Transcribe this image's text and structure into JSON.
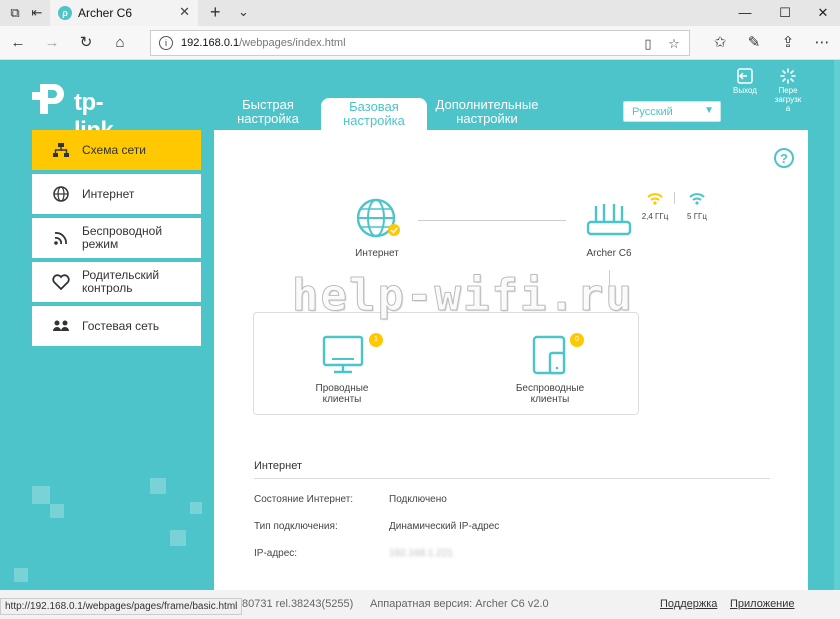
{
  "browser": {
    "tab_title": "Archer C6",
    "tab_close": "✕",
    "new_tab": "+",
    "tab_list": "⌄",
    "url_host": "192.168.0.1",
    "url_path": "/webpages/index.html",
    "status_url": "http://192.168.0.1/webpages/pages/frame/basic.html",
    "window_min": "—",
    "window_max": "☐",
    "window_close": "✕"
  },
  "brand": {
    "name": "tp-link"
  },
  "tabs": [
    {
      "label_1": "Быстрая",
      "label_2": "настройка"
    },
    {
      "label_1": "Базовая",
      "label_2": "настройка"
    },
    {
      "label_1": "Дополнительные",
      "label_2": "настройки"
    }
  ],
  "language": {
    "selected": "Русский"
  },
  "top_actions": {
    "logout": "Выход",
    "reboot_1": "Пере",
    "reboot_2": "загрузк",
    "reboot_3": "а"
  },
  "sidebar": {
    "items": [
      {
        "label_1": "Схема сети",
        "label_2": ""
      },
      {
        "label_1": "Интернет",
        "label_2": ""
      },
      {
        "label_1": "Беспроводной",
        "label_2": "режим"
      },
      {
        "label_1": "Родительский",
        "label_2": "контроль"
      },
      {
        "label_1": "Гостевая сеть",
        "label_2": ""
      }
    ]
  },
  "network_map": {
    "internet_label": "Интернет",
    "router_label": "Archer C6",
    "band_24": "2,4 ГГц",
    "band_5": "5 ГГц",
    "wired_1": "Проводные",
    "wired_2": "клиенты",
    "wired_count": "1",
    "wireless_1": "Беспроводные",
    "wireless_2": "клиенты",
    "wireless_count": "0"
  },
  "watermark": "help-wifi.ru",
  "internet_section": {
    "title": "Интернет",
    "rows": [
      {
        "label": "Состояние Интернет:",
        "value": "Подключено"
      },
      {
        "label": "Тип подключения:",
        "value": "Динамический IP-адрес"
      },
      {
        "label": "IP-адрес:",
        "value": "192.168.1.221"
      }
    ]
  },
  "footer": {
    "firmware": "Версия встроенного ПО: 1.0.3 Build 20180731 rel.38243(5255)",
    "hardware": "Аппаратная версия: Archer C6 v2.0",
    "support": "Поддержка",
    "app": "Приложение"
  },
  "colors": {
    "accent": "#4cc4c9",
    "active_menu": "#ffc800"
  }
}
